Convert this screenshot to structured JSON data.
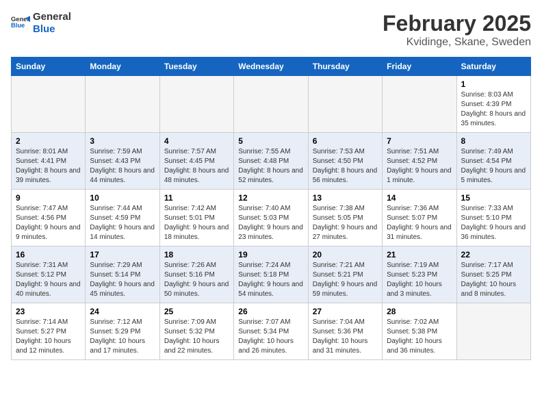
{
  "header": {
    "logo_line1": "General",
    "logo_line2": "Blue",
    "month_year": "February 2025",
    "location": "Kvidinge, Skane, Sweden"
  },
  "weekdays": [
    "Sunday",
    "Monday",
    "Tuesday",
    "Wednesday",
    "Thursday",
    "Friday",
    "Saturday"
  ],
  "weeks": [
    [
      {
        "day": "",
        "info": ""
      },
      {
        "day": "",
        "info": ""
      },
      {
        "day": "",
        "info": ""
      },
      {
        "day": "",
        "info": ""
      },
      {
        "day": "",
        "info": ""
      },
      {
        "day": "",
        "info": ""
      },
      {
        "day": "1",
        "info": "Sunrise: 8:03 AM\nSunset: 4:39 PM\nDaylight: 8 hours and 35 minutes."
      }
    ],
    [
      {
        "day": "2",
        "info": "Sunrise: 8:01 AM\nSunset: 4:41 PM\nDaylight: 8 hours and 39 minutes."
      },
      {
        "day": "3",
        "info": "Sunrise: 7:59 AM\nSunset: 4:43 PM\nDaylight: 8 hours and 44 minutes."
      },
      {
        "day": "4",
        "info": "Sunrise: 7:57 AM\nSunset: 4:45 PM\nDaylight: 8 hours and 48 minutes."
      },
      {
        "day": "5",
        "info": "Sunrise: 7:55 AM\nSunset: 4:48 PM\nDaylight: 8 hours and 52 minutes."
      },
      {
        "day": "6",
        "info": "Sunrise: 7:53 AM\nSunset: 4:50 PM\nDaylight: 8 hours and 56 minutes."
      },
      {
        "day": "7",
        "info": "Sunrise: 7:51 AM\nSunset: 4:52 PM\nDaylight: 9 hours and 1 minute."
      },
      {
        "day": "8",
        "info": "Sunrise: 7:49 AM\nSunset: 4:54 PM\nDaylight: 9 hours and 5 minutes."
      }
    ],
    [
      {
        "day": "9",
        "info": "Sunrise: 7:47 AM\nSunset: 4:56 PM\nDaylight: 9 hours and 9 minutes."
      },
      {
        "day": "10",
        "info": "Sunrise: 7:44 AM\nSunset: 4:59 PM\nDaylight: 9 hours and 14 minutes."
      },
      {
        "day": "11",
        "info": "Sunrise: 7:42 AM\nSunset: 5:01 PM\nDaylight: 9 hours and 18 minutes."
      },
      {
        "day": "12",
        "info": "Sunrise: 7:40 AM\nSunset: 5:03 PM\nDaylight: 9 hours and 23 minutes."
      },
      {
        "day": "13",
        "info": "Sunrise: 7:38 AM\nSunset: 5:05 PM\nDaylight: 9 hours and 27 minutes."
      },
      {
        "day": "14",
        "info": "Sunrise: 7:36 AM\nSunset: 5:07 PM\nDaylight: 9 hours and 31 minutes."
      },
      {
        "day": "15",
        "info": "Sunrise: 7:33 AM\nSunset: 5:10 PM\nDaylight: 9 hours and 36 minutes."
      }
    ],
    [
      {
        "day": "16",
        "info": "Sunrise: 7:31 AM\nSunset: 5:12 PM\nDaylight: 9 hours and 40 minutes."
      },
      {
        "day": "17",
        "info": "Sunrise: 7:29 AM\nSunset: 5:14 PM\nDaylight: 9 hours and 45 minutes."
      },
      {
        "day": "18",
        "info": "Sunrise: 7:26 AM\nSunset: 5:16 PM\nDaylight: 9 hours and 50 minutes."
      },
      {
        "day": "19",
        "info": "Sunrise: 7:24 AM\nSunset: 5:18 PM\nDaylight: 9 hours and 54 minutes."
      },
      {
        "day": "20",
        "info": "Sunrise: 7:21 AM\nSunset: 5:21 PM\nDaylight: 9 hours and 59 minutes."
      },
      {
        "day": "21",
        "info": "Sunrise: 7:19 AM\nSunset: 5:23 PM\nDaylight: 10 hours and 3 minutes."
      },
      {
        "day": "22",
        "info": "Sunrise: 7:17 AM\nSunset: 5:25 PM\nDaylight: 10 hours and 8 minutes."
      }
    ],
    [
      {
        "day": "23",
        "info": "Sunrise: 7:14 AM\nSunset: 5:27 PM\nDaylight: 10 hours and 12 minutes."
      },
      {
        "day": "24",
        "info": "Sunrise: 7:12 AM\nSunset: 5:29 PM\nDaylight: 10 hours and 17 minutes."
      },
      {
        "day": "25",
        "info": "Sunrise: 7:09 AM\nSunset: 5:32 PM\nDaylight: 10 hours and 22 minutes."
      },
      {
        "day": "26",
        "info": "Sunrise: 7:07 AM\nSunset: 5:34 PM\nDaylight: 10 hours and 26 minutes."
      },
      {
        "day": "27",
        "info": "Sunrise: 7:04 AM\nSunset: 5:36 PM\nDaylight: 10 hours and 31 minutes."
      },
      {
        "day": "28",
        "info": "Sunrise: 7:02 AM\nSunset: 5:38 PM\nDaylight: 10 hours and 36 minutes."
      },
      {
        "day": "",
        "info": ""
      }
    ]
  ]
}
